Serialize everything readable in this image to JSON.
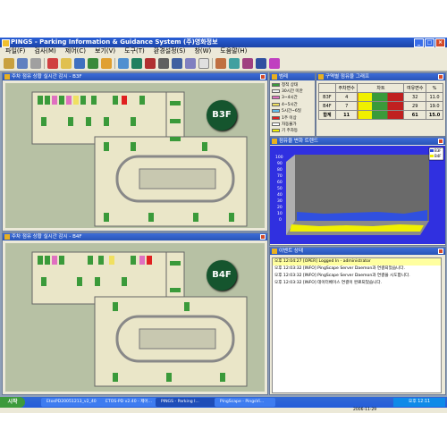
{
  "window": {
    "title": "PINGS - Parking Information & Guidance System (주)영화정보"
  },
  "menu": [
    "파일(F)",
    "검사(M)",
    "제어(C)",
    "보기(V)",
    "도구(T)",
    "환경설정(S)",
    "창(W)",
    "도움말(H)"
  ],
  "panels": {
    "b3f": {
      "title": "주차 점유 상황 실시간 감시 - B3F",
      "floor": "B3F"
    },
    "b4f": {
      "title": "주차 점유 상황 실시간 감시 - B4F",
      "floor": "B4F"
    },
    "legend": {
      "title": "범례",
      "items": [
        {
          "label": "정적 상태",
          "color": "#3a9a3a"
        },
        {
          "label": "30시간 미만",
          "color": "#f0f0f0"
        },
        {
          "label": "3~4시간",
          "color": "#e070c0"
        },
        {
          "label": "4~5시간",
          "color": "#f0e060"
        },
        {
          "label": "5시간~6일",
          "color": "#60c0f0"
        },
        {
          "label": "1주 이상",
          "color": "#e02020"
        },
        {
          "label": "자동불가",
          "color": "#ffffff"
        },
        {
          "label": "기 주차등",
          "color": "#f0f000"
        },
        {
          "label": "통기사항",
          "color": "#c03030"
        }
      ]
    },
    "stats": {
      "title": "구역별 점유율 그래프",
      "headers": [
        "",
        "주차면수",
        "차트",
        "여유면수",
        "%"
      ],
      "rows": [
        {
          "name": "B3F",
          "count": "4",
          "free": "32",
          "pct": "11.0"
        },
        {
          "name": "B4F",
          "count": "7",
          "free": "29",
          "pct": "19.0"
        },
        {
          "name": "합계",
          "count": "11",
          "free": "61",
          "pct": "15.0"
        }
      ]
    },
    "chart": {
      "title": "점유율 변화 트렌드",
      "legend": [
        "B3F",
        "B4F"
      ],
      "ylabels": [
        "100",
        "90",
        "80",
        "70",
        "60",
        "50",
        "40",
        "30",
        "20",
        "10",
        "0"
      ]
    },
    "log": {
      "title": "이벤트 상태",
      "lines": [
        "오후 12:04:27  [OPER] Logged In - administrator",
        "오후 12:03:32  [INFO] PingScape Server Daemon과 연결되었습니다.",
        "오후 12:03:32  [INFO] PingScape Server Daemon과 연결을 시도합니다.",
        "오후 12:03:32  [INFO] 데이터베이스 연결이 완료되었습니다."
      ]
    }
  },
  "taskbar": {
    "start": "시작",
    "tasks": [
      "EtosPD20051213_v2_40",
      "ETOS-PD v2.40 - 제어...",
      "PINGS - Parking I...",
      "PingScape - PingsVi..."
    ],
    "clock": "오후 12:11",
    "date": "2006-11-29"
  },
  "colors": {
    "titlebar": "#2a5fd6",
    "mdi": "#8fa0b8",
    "badge": "#15552e",
    "chartbg": "#3030e0"
  }
}
